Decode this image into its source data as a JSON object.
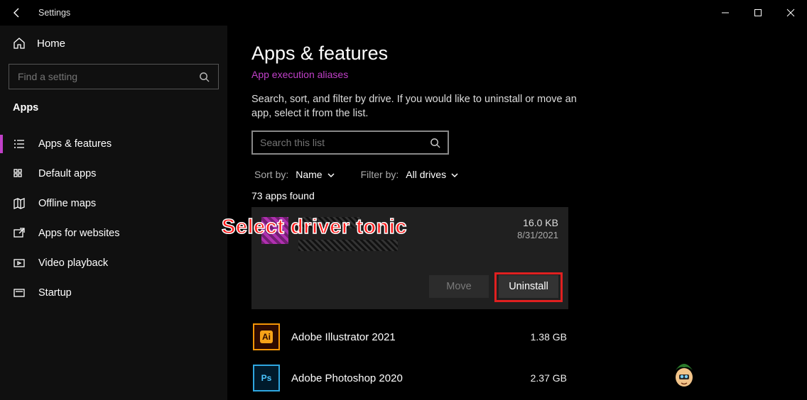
{
  "titlebar": {
    "title": "Settings"
  },
  "sidebar": {
    "home_label": "Home",
    "search_placeholder": "Find a setting",
    "section_label": "Apps",
    "items": [
      {
        "label": "Apps & features"
      },
      {
        "label": "Default apps"
      },
      {
        "label": "Offline maps"
      },
      {
        "label": "Apps for websites"
      },
      {
        "label": "Video playback"
      },
      {
        "label": "Startup"
      }
    ]
  },
  "main": {
    "title": "Apps & features",
    "link": "App execution aliases",
    "description": "Search, sort, and filter by drive. If you would like to uninstall or move an app, select it from the list.",
    "search_placeholder": "Search this list",
    "sort_label": "Sort by:",
    "sort_value": "Name",
    "filter_label": "Filter by:",
    "filter_value": "All drives",
    "count_text": "73 apps found",
    "selected_app": {
      "size": "16.0 KB",
      "date": "8/31/2021",
      "move_label": "Move",
      "uninstall_label": "Uninstall"
    },
    "apps": [
      {
        "name": "Adobe Illustrator 2021",
        "size": "1.38 GB",
        "badge": "Ai"
      },
      {
        "name": "Adobe Photoshop 2020",
        "size": "2.37 GB",
        "badge": "Ps"
      }
    ]
  },
  "annotation": "Select driver tonic"
}
